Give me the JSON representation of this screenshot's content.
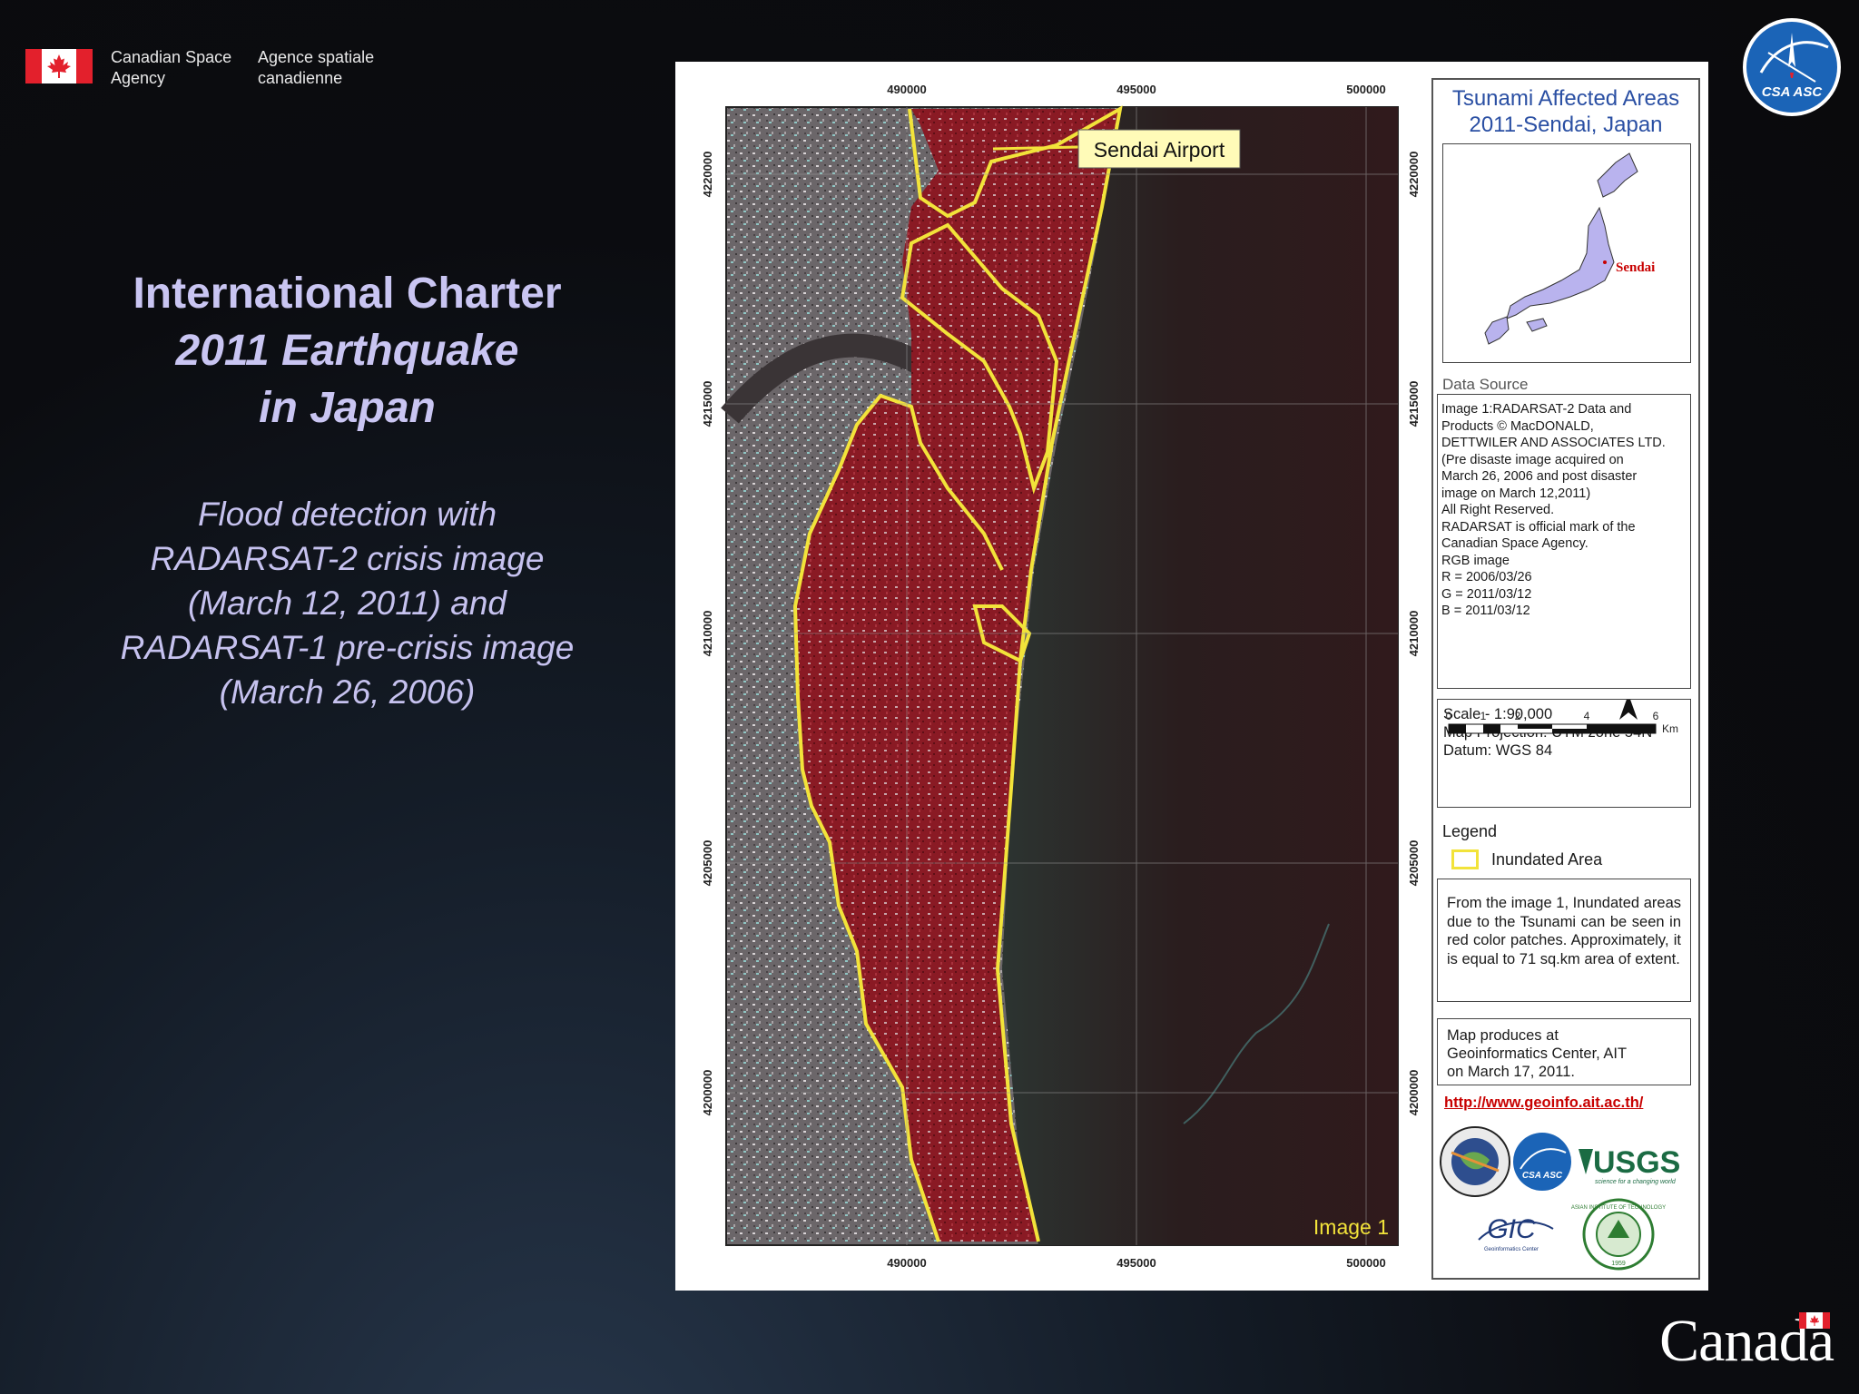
{
  "agency": {
    "name_en": [
      "Canadian Space",
      "Agency"
    ],
    "name_fr": [
      "Agence spatiale",
      "canadienne"
    ],
    "logo_text": "CSA ASC",
    "wordmark": "Canada"
  },
  "slide": {
    "title_lines": [
      "International Charter",
      "2011 Earthquake",
      "in Japan"
    ],
    "subtitle_lines": [
      "Flood detection with",
      "RADARSAT-2 crisis image",
      "(March 12, 2011) and",
      "RADARSAT-1 pre-crisis image",
      "(March 26, 2006)"
    ]
  },
  "map": {
    "x_ticks": [
      "490000",
      "495000",
      "500000"
    ],
    "y_ticks": [
      "4220000",
      "4215000",
      "4210000",
      "4205000",
      "4200000"
    ],
    "airport_label": "Sendai Airport",
    "image_label": "Image 1",
    "panel_title_lines": [
      "Tsunami Affected Areas",
      "2011-Sendai, Japan"
    ],
    "inset_label": "Sendai",
    "data_source_heading": "Data Source",
    "data_source_lines": [
      "Image 1:RADARSAT-2 Data and",
      "Products © MacDONALD,",
      "DETTWILER AND ASSOCIATES LTD.",
      "(Pre disaste image acquired on",
      "March 26, 2006 and post disaster",
      "image on March 12,2011)",
      "All Right Reserved.",
      "RADARSAT is official mark of the",
      "Canadian Space Agency.",
      "RGB image",
      "R = 2006/03/26",
      "G = 2011/03/12",
      "B = 2011/03/12"
    ],
    "scale_text": "Scale - 1:90,000",
    "projection_text": "Map Projection: UTM zone 54N",
    "datum_text": "Datum: WGS 84",
    "scale_ticks": [
      "0",
      "1",
      "2",
      "4",
      "6"
    ],
    "scale_unit": "Km",
    "north_label": "N",
    "legend_heading": "Legend",
    "legend_item": "Inundated Area",
    "note": "From the image 1, Inundated areas due to the Tsunami can be seen in red color patches. Approximately, it is equal to 71 sq.km area of extent.",
    "credit_lines": [
      "Map produces at",
      "Geoinformatics Center, AIT",
      "on March 17, 2011."
    ],
    "url": "http://www.geoinfo.ait.ac.th/",
    "logos": {
      "usgs": "USGS",
      "usgs_tagline": "science for a changing world",
      "csa": "CSA ASC",
      "gic": "GIC",
      "gic_caption": "Geoinformatics Center",
      "ait_ring": "ASIAN INSTITUTE OF TECHNOLOGY",
      "ait_year": "1959"
    },
    "colors": {
      "inundated_outline": "#f2e33a",
      "flood_red": "#8a1a24",
      "sea": "#241a1a"
    }
  }
}
